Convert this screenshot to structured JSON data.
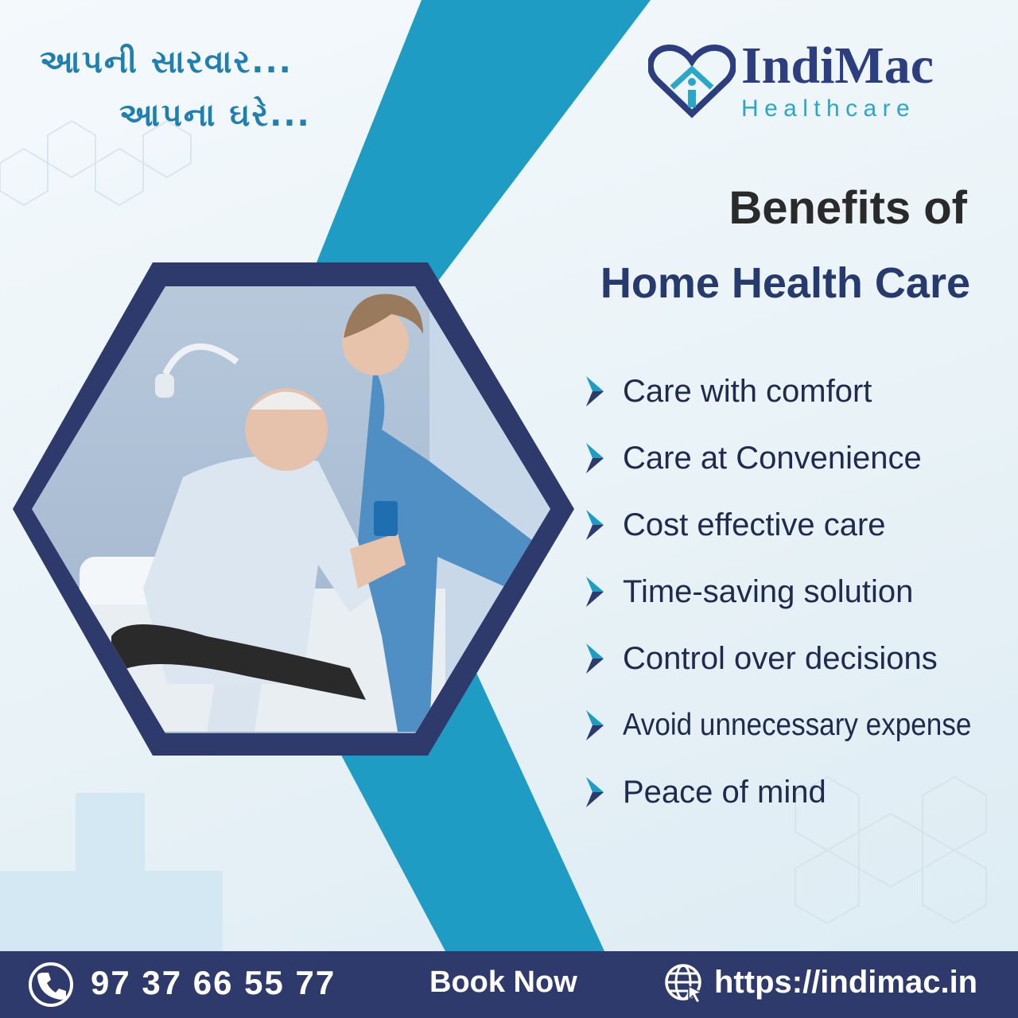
{
  "tagline": {
    "line1": "આપની સારવાર...",
    "line2": "આપના ઘરે..."
  },
  "brand": {
    "name": "IndiMac",
    "subtitle": "Healthcare",
    "logo_icon": "heart-house-icon"
  },
  "heading": {
    "line1": "Benefits of",
    "line2": "Home Health Care"
  },
  "benefits": [
    "Care with comfort",
    "Care at Convenience",
    "Cost effective care",
    "Time-saving solution",
    "Control over decisions",
    "Avoid unnecessary expense",
    "Peace of mind"
  ],
  "photo": {
    "subject": "nurse-helping-elderly-patient-photo"
  },
  "footer": {
    "phone": "97 37 66 55 77",
    "book_label": "Book Now",
    "website": "https://indimac.in",
    "phone_icon": "phone-icon",
    "web_icon": "globe-cursor-icon"
  },
  "colors": {
    "navy": "#2e3a6b",
    "teal": "#1f9cc4",
    "brand_blue": "#2c3e7f",
    "accent_cyan": "#2aa6c9",
    "background": "#eef5f9"
  }
}
